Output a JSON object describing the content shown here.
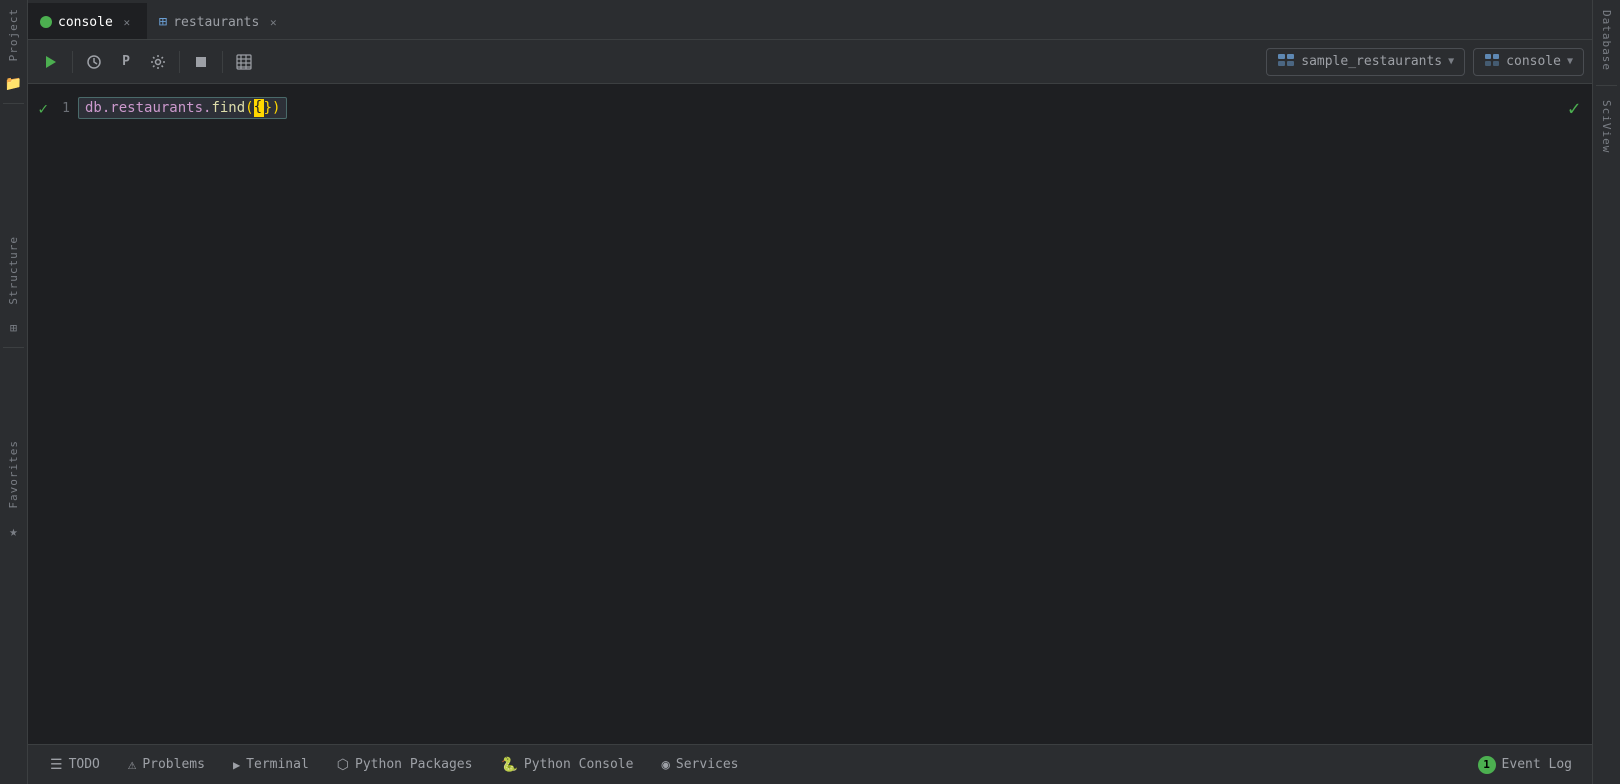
{
  "tabs": [
    {
      "id": "console",
      "label": "console",
      "icon": "console",
      "active": true
    },
    {
      "id": "restaurants",
      "label": "restaurants",
      "icon": "table",
      "active": false
    }
  ],
  "toolbar": {
    "run_label": "▶",
    "history_label": "⏱",
    "profile_label": "P",
    "settings_label": "🔧",
    "stop_label": "■",
    "table_label": "≡",
    "db_selector": "sample_restaurants",
    "console_selector": "console"
  },
  "editor": {
    "line_number": "1",
    "code": "db.restaurants.find({})",
    "code_parts": {
      "db": "db",
      "dot1": ".",
      "collection": "restaurants",
      "dot2": ".",
      "method": "find",
      "open_paren": "(",
      "open_brace": "{",
      "close_brace": "}",
      "close_paren": ")"
    }
  },
  "right_sidebar": {
    "database_label": "Database",
    "sciview_label": "SciView"
  },
  "left_sidebar": {
    "project_label": "Project",
    "structure_label": "Structure",
    "favorites_label": "Favorites"
  },
  "bottom_bar": {
    "tabs": [
      {
        "id": "todo",
        "label": "TODO",
        "icon": "☰"
      },
      {
        "id": "problems",
        "label": "Problems",
        "icon": "⚠"
      },
      {
        "id": "terminal",
        "label": "Terminal",
        "icon": "▶"
      },
      {
        "id": "python-packages",
        "label": "Python Packages",
        "icon": "⬡"
      },
      {
        "id": "python-console",
        "label": "Python Console",
        "icon": "🐍"
      },
      {
        "id": "services",
        "label": "Services",
        "icon": "◉"
      }
    ],
    "event_log": {
      "label": "Event Log",
      "badge": "1"
    }
  },
  "colors": {
    "accent_green": "#4caf50",
    "accent_blue": "#6b9fd4",
    "accent_yellow": "#ffd700",
    "bg_main": "#1e1f22",
    "bg_sidebar": "#2b2d30",
    "text_muted": "#7a7e85",
    "text_primary": "#cccccc"
  }
}
